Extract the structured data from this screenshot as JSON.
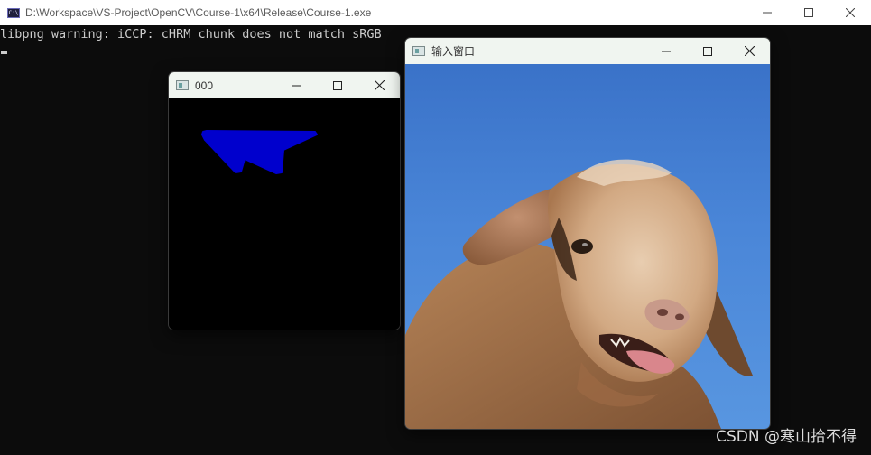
{
  "console": {
    "title": "D:\\Workspace\\VS-Project\\OpenCV\\Course-1\\x64\\Release\\Course-1.exe",
    "icon_text": "C:\\",
    "output_line": "libpng warning: iCCP: cHRM chunk does not match sRGB"
  },
  "window_000": {
    "title": "000",
    "polygon_color": "#0000cd"
  },
  "window_input": {
    "title": "输入窗口",
    "image_description_icon": "sheep-photo"
  },
  "watermark": {
    "text": "CSDN @寒山拾不得"
  },
  "icons": {
    "minimize": "minimize-icon",
    "maximize": "maximize-icon",
    "close": "close-icon"
  }
}
